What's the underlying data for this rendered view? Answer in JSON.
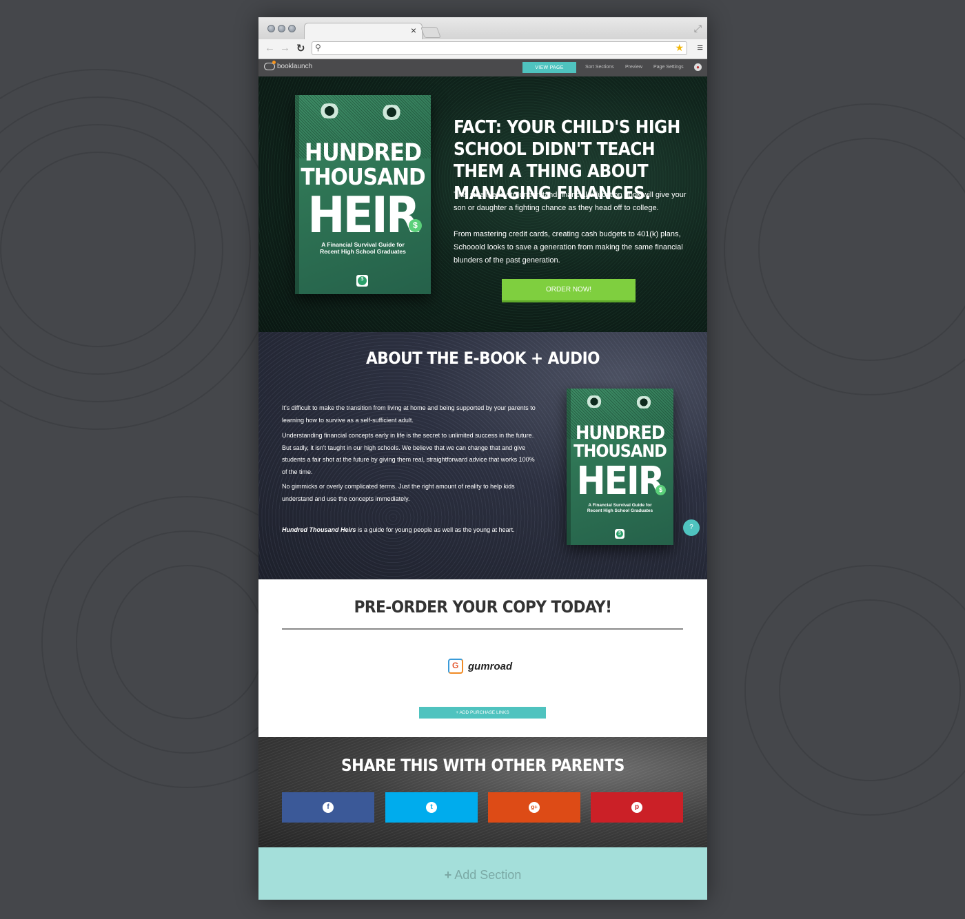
{
  "browser": {
    "tab_close": "×",
    "url_value": "",
    "icons": [
      "back-icon",
      "forward-icon",
      "reload-icon",
      "search-icon",
      "star-icon",
      "menu-icon",
      "expand-icon"
    ]
  },
  "appbar": {
    "logo_text": "booklaunch",
    "view_page": "VIEW PAGE",
    "nav": [
      "Sort Sections",
      "Preview",
      "Page Settings"
    ]
  },
  "book": {
    "title_line1": "HUNDRED",
    "title_line2": "THOUSAND",
    "title_line3": "HEIR",
    "dollar": "$",
    "subtitle_line1": "A Financial Survival Guide for",
    "subtitle_line2": "Recent High School Graduates"
  },
  "hero": {
    "heading": "FACT: YOUR CHILD'S HIGH SCHOOL DIDN'T TEACH THEM A THING ABOUT MANAGING FINANCES.",
    "paragraph1": "This small, easy-to-understand financial education book will give your son or daughter a fighting chance as they head off to college.",
    "paragraph2": "From mastering credit cards, creating cash budgets to 401(k) plans, Schooold looks to save a generation from making the same financial blunders of the past generation.",
    "cta": "ORDER NOW!"
  },
  "about": {
    "heading": "ABOUT THE E-BOOK + AUDIO",
    "paragraphs": [
      "It's difficult to make the transition from living at home and being supported by your parents to learning how to survive as a self-sufficient adult.",
      "Understanding financial concepts early in life is the secret to unlimited success in the future. But sadly, it isn't taught in our high schools. We believe that we can change that and give students a fair shot at the future by giving them real, straightforward advice that works 100% of the time.",
      "No gimmicks or overly complicated terms. Just the right amount of reality to help kids understand and use the concepts immediately."
    ],
    "closing_emphasis": "Hundred Thousand Heirs",
    "closing_rest": " is a guide for young people as well as the young at heart.",
    "chat_icon": "?"
  },
  "preorder": {
    "heading": "PRE-ORDER YOUR COPY TODAY!",
    "vendor": "gumroad",
    "add_links": "+ ADD PURCHASE LINKS"
  },
  "share": {
    "heading": "SHARE THIS WITH OTHER PARENTS",
    "buttons": [
      {
        "name": "facebook",
        "glyph": "f",
        "color": "#3b5998"
      },
      {
        "name": "twitter",
        "glyph": "t",
        "color": "#00aced"
      },
      {
        "name": "google-plus",
        "glyph": "g+",
        "color": "#dd4b16"
      },
      {
        "name": "pinterest",
        "glyph": "p",
        "color": "#cb2027"
      }
    ]
  },
  "add_section": {
    "label": "Add Section",
    "plus": "+"
  },
  "colors": {
    "accent_teal": "#4fc3bf",
    "cta_green": "#7fcf3f",
    "add_section_bg": "#a4dfda"
  }
}
